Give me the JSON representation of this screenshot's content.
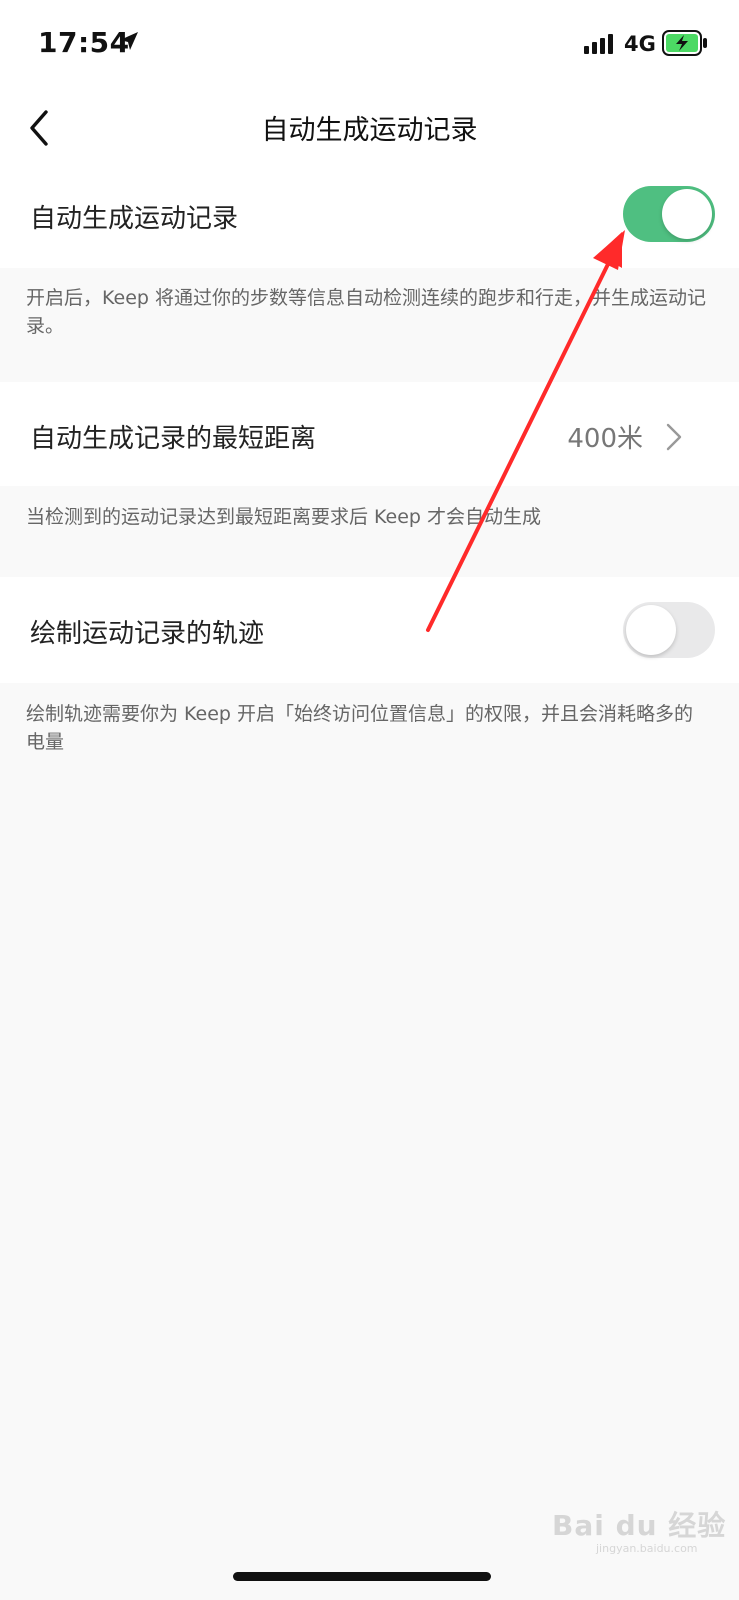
{
  "status_bar": {
    "time": "17:54",
    "network": "4G",
    "icons": [
      "location-arrow-icon",
      "signal-bars-icon",
      "battery-charging-icon"
    ]
  },
  "nav": {
    "back_icon": "chevron-left-icon",
    "title": "自动生成运动记录"
  },
  "settings": [
    {
      "label": "自动生成运动记录",
      "toggle": "on",
      "description": "开启后，Keep 将通过你的步数等信息自动检测连续的跑步和行走，并生成运动记录。"
    },
    {
      "label": "自动生成记录的最短距离",
      "value": "400米",
      "chevron_icon": "chevron-right-icon",
      "description": "当检测到的运动记录达到最短距离要求后 Keep 才会自动生成"
    },
    {
      "label": "绘制运动记录的轨迹",
      "toggle": "off",
      "description": "绘制轨迹需要你为 Keep 开启「始终访问位置信息」的权限，并且会消耗略多的电量"
    }
  ],
  "watermark": {
    "text": "Bai du 经验",
    "subtext": "jingyan.baidu.com"
  },
  "colors": {
    "toggle_on": "#4fbf81",
    "toggle_off": "#e9e9ea",
    "annotation_arrow": "#ff2a2a",
    "page_background": "#f9f9f9"
  }
}
